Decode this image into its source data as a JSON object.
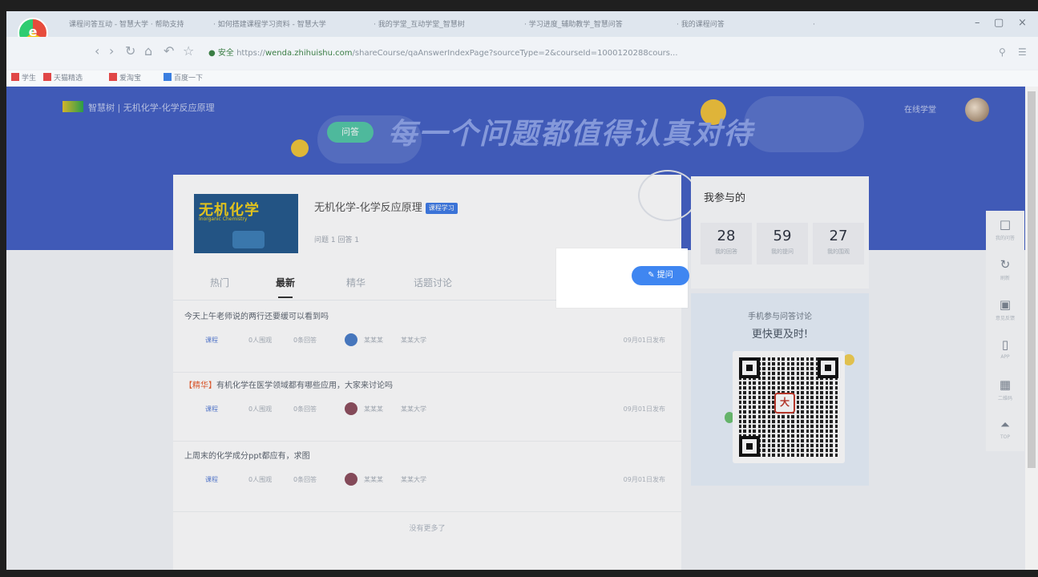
{
  "browser": {
    "tabs": [
      {
        "label": "课程问答互动 - 智慧大学 · 帮助支持"
      },
      {
        "label": "· 如何搭建课程学习资料 - 智慧大学"
      },
      {
        "label": "· 我的学堂_互动学堂_智慧树"
      },
      {
        "label": "· 学习进度_辅助教学_智慧问答"
      },
      {
        "label": "· 我的课程问答"
      },
      {
        "label": "·"
      }
    ],
    "window_controls": {
      "minimize": "–",
      "maximize": "▢",
      "close": "×"
    },
    "secure_label": "● 安全",
    "url_scheme": "https://",
    "url_host": "wenda.zhihuishu.com",
    "url_path": "/shareCourse/qaAnswerIndexPage?sourceType=2&courseId=1000120288cours...",
    "bookmarks": [
      "学生",
      "天猫精选",
      "爱淘宝",
      "百度一下"
    ],
    "bookmark_colors": [
      "#e04747",
      "#e04747",
      "#e04747",
      "#3a7ee0"
    ]
  },
  "header": {
    "brand": "智慧树 | 无机化学-化学反应原理",
    "slogan_tag": "问答",
    "slogan": "每一个问题都值得认真对待",
    "user_link": "在线学堂"
  },
  "course": {
    "cover_title": "无机化学",
    "cover_subtitle": "Inorganic Chemistry",
    "title": "无机化学-化学反应原理",
    "badge": "课程学习",
    "stats": "问题 1      回答 1"
  },
  "tabs": [
    {
      "label": "热门",
      "active": false
    },
    {
      "label": "最新",
      "active": true
    },
    {
      "label": "精华",
      "active": false
    },
    {
      "label": "话题讨论",
      "active": false
    }
  ],
  "ask_button": "提问",
  "questions": [
    {
      "tag": "",
      "title": "今天上午老师说的两行还要缓可以看到吗",
      "category": "课程",
      "views": "0人围观",
      "answers": "0条回答",
      "author": "某某某",
      "school": "某某大学",
      "time": "09月01日发布",
      "avatar_color": "#4a7ec9"
    },
    {
      "tag": "【精华】",
      "title": "有机化学在医学领域都有哪些应用，大家来讨论吗",
      "category": "课程",
      "views": "0人围观",
      "answers": "0条回答",
      "author": "某某某",
      "school": "某某大学",
      "time": "09月01日发布",
      "avatar_color": "#8e4f5e"
    },
    {
      "tag": "",
      "title": "上周末的化学成分ppt都应有，求图",
      "category": "课程",
      "views": "0人围观",
      "answers": "0条回答",
      "author": "某某某",
      "school": "某某大学",
      "time": "09月01日发布",
      "avatar_color": "#8e4f5e"
    }
  ],
  "no_more": "没有更多了",
  "side": {
    "title": "我参与的",
    "stats": [
      {
        "num": "28",
        "label": "我的回答"
      },
      {
        "num": "59",
        "label": "我的提问"
      },
      {
        "num": "27",
        "label": "我的围观"
      }
    ],
    "qr_line1": "手机参与问答讨论",
    "qr_line2": "更快更及时!",
    "qr_center": "大"
  },
  "floatbar": [
    {
      "icon": "□",
      "label": "我的问答",
      "name": "my-qa-icon"
    },
    {
      "icon": "↻",
      "label": "刷新",
      "name": "refresh-icon"
    },
    {
      "icon": "▣",
      "label": "意见反馈",
      "name": "feedback-icon"
    },
    {
      "icon": "▯",
      "label": "APP",
      "name": "app-icon"
    },
    {
      "icon": "▦",
      "label": "二维码",
      "name": "qr-icon"
    },
    {
      "icon": "⏶",
      "label": "TOP",
      "name": "back-to-top-icon"
    }
  ],
  "colors": {
    "banner": "#4460c4",
    "accent": "#3f86f1",
    "highlight_tag": "#e85a2a"
  }
}
